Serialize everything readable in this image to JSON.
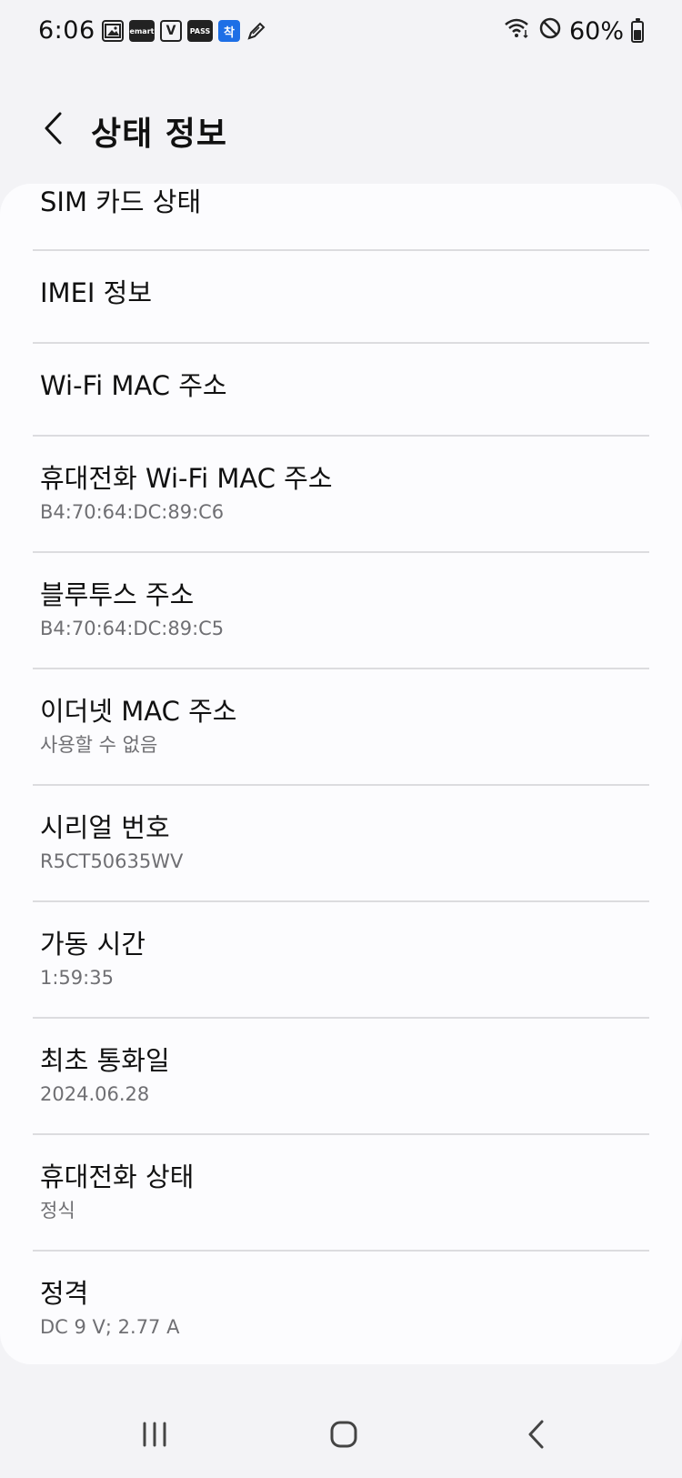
{
  "status_bar": {
    "time": "6:06",
    "battery": "60%",
    "battery_level": 0.6,
    "notification_icons": [
      "gallery-icon",
      "emart-icon",
      "v1-icon",
      "pass-icon",
      "blue-app-icon",
      "pen-icon"
    ],
    "emart_label": "emart",
    "v1_label": "V",
    "pass_label": "PASS",
    "blue_label": "착"
  },
  "header": {
    "title": "상태 정보"
  },
  "items": [
    {
      "title": "SIM 카드 상태",
      "sub": ""
    },
    {
      "title": "IMEI 정보",
      "sub": ""
    },
    {
      "title": "Wi-Fi MAC 주소",
      "sub": ""
    },
    {
      "title": "휴대전화 Wi-Fi MAC 주소",
      "sub": "B4:70:64:DC:89:C6"
    },
    {
      "title": "블루투스 주소",
      "sub": "B4:70:64:DC:89:C5"
    },
    {
      "title": "이더넷 MAC 주소",
      "sub": "사용할 수 없음"
    },
    {
      "title": "시리얼 번호",
      "sub": "R5CT50635WV"
    },
    {
      "title": "가동 시간",
      "sub": "1:59:35"
    },
    {
      "title": "최초 통화일",
      "sub": "2024.06.28"
    },
    {
      "title": "휴대전화 상태",
      "sub": "정식"
    },
    {
      "title": "정격",
      "sub": "DC 9 V; 2.77 A"
    }
  ],
  "colors": {
    "background": "#f3f3f6",
    "card": "#fcfcfe",
    "text": "#111111",
    "subtext": "#6f6f73",
    "divider": "#dcdcdf"
  }
}
